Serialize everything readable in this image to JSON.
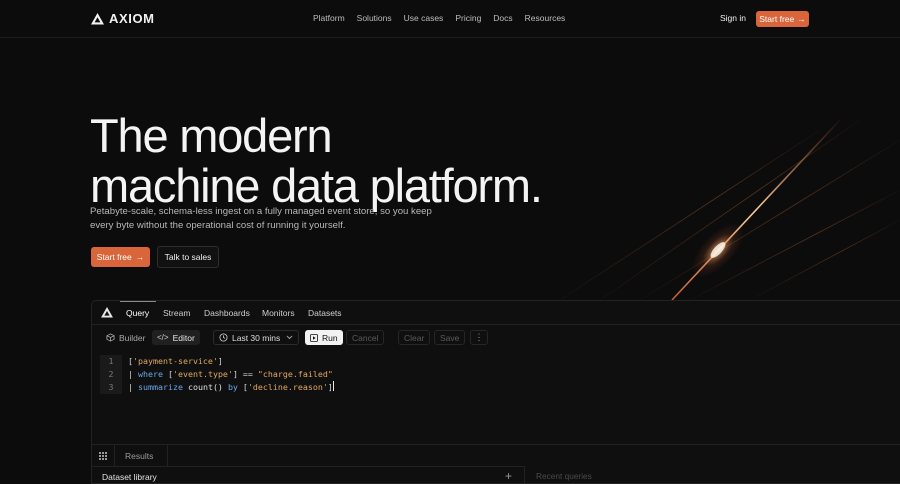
{
  "brand": {
    "name": "AXIOM",
    "logo_icon": "axiom-logo-icon",
    "accent": "#d9663a"
  },
  "nav": {
    "menu": [
      "Platform",
      "Solutions",
      "Use cases",
      "Pricing",
      "Docs",
      "Resources"
    ],
    "signin": "Sign in",
    "cta": "Start free",
    "cta_icon": "arrow-right-icon"
  },
  "hero": {
    "title_line1": "The modern",
    "title_line2": "machine data platform.",
    "subtitle_line1": "Petabyte-scale, schema-less ingest on a fully managed event store, so you keep",
    "subtitle_line2": "every byte without the operational cost of running it yourself.",
    "primary": "Start free",
    "secondary": "Talk to sales"
  },
  "app": {
    "tabs": [
      "Query",
      "Stream",
      "Dashboards",
      "Monitors",
      "Datasets"
    ],
    "active_tab": "Query",
    "toolbar": {
      "builder": "Builder",
      "editor": "Editor",
      "time_range": "Last 30 mins",
      "run": "Run",
      "cancel": "Cancel",
      "clear": "Clear",
      "save": "Save"
    },
    "code": {
      "line_numbers": [
        "1",
        "2",
        "3"
      ],
      "l1_open": "[",
      "l1_dataset": "'payment-service'",
      "l1_close": "]",
      "l2_pipe": "| ",
      "l2_kw": "where",
      "l2_open": " [",
      "l2_field": "'event.type'",
      "l2_op": "] == ",
      "l2_value": "\"charge.failed\"",
      "l3_pipe": "| ",
      "l3_kw": "summarize",
      "l3_fn": " count() ",
      "l3_by": "by",
      "l3_open": " [",
      "l3_field": "'decline.reason'",
      "l3_close": "]"
    },
    "bottom": {
      "results": "Results",
      "dataset_library": "Dataset library",
      "recent_queries": "Recent queries"
    }
  }
}
